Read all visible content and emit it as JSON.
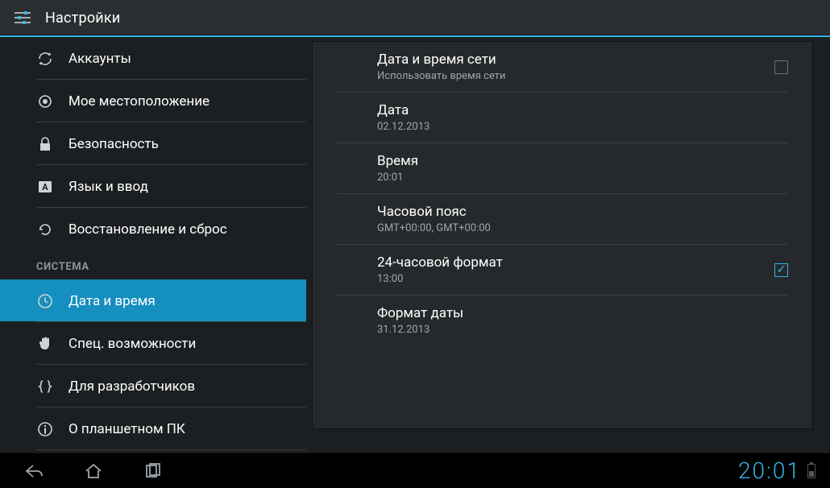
{
  "app": {
    "title": "Настройки"
  },
  "sidebar": {
    "items": [
      {
        "label": "Аккаунты",
        "icon": "sync-icon"
      },
      {
        "label": "Мое местоположение",
        "icon": "location-icon"
      },
      {
        "label": "Безопасность",
        "icon": "lock-icon"
      },
      {
        "label": "Язык и ввод",
        "icon": "language-icon"
      },
      {
        "label": "Восстановление и сброс",
        "icon": "restore-icon"
      }
    ],
    "section_header": "СИСТЕМА",
    "items2": [
      {
        "label": "Дата и время",
        "icon": "clock-icon",
        "selected": true
      },
      {
        "label": "Спец. возможности",
        "icon": "hand-icon"
      },
      {
        "label": "Для разработчиков",
        "icon": "braces-icon"
      },
      {
        "label": "О планшетном ПК",
        "icon": "info-icon"
      }
    ]
  },
  "detail": {
    "items": [
      {
        "title": "Дата и время сети",
        "sub": "Использовать время сети",
        "checkbox": true,
        "checked": false
      },
      {
        "title": "Дата",
        "sub": "02.12.2013"
      },
      {
        "title": "Время",
        "sub": "20:01"
      },
      {
        "title": "Часовой пояс",
        "sub": "GMT+00:00, GMT+00:00"
      },
      {
        "title": "24-часовой формат",
        "sub": "13:00",
        "checkbox": true,
        "checked": true
      },
      {
        "title": "Формат даты",
        "sub": "31.12.2013"
      }
    ]
  },
  "statusbar": {
    "clock": "20:01"
  },
  "colors": {
    "accent": "#33b5e5",
    "selected": "#158fbf",
    "panel": "#26292b",
    "bg": "#1c1f21"
  }
}
